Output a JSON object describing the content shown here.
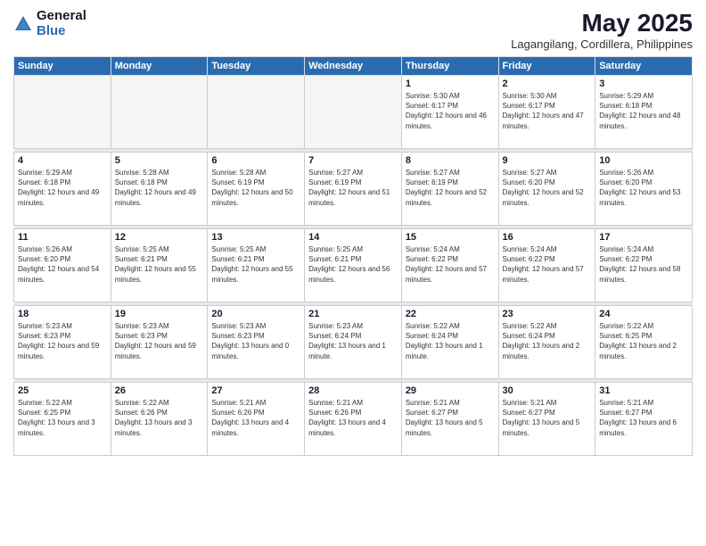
{
  "header": {
    "logo_general": "General",
    "logo_blue": "Blue",
    "month_title": "May 2025",
    "location": "Lagangilang, Cordillera, Philippines"
  },
  "days_of_week": [
    "Sunday",
    "Monday",
    "Tuesday",
    "Wednesday",
    "Thursday",
    "Friday",
    "Saturday"
  ],
  "weeks": [
    {
      "days": [
        {
          "num": "",
          "info": ""
        },
        {
          "num": "",
          "info": ""
        },
        {
          "num": "",
          "info": ""
        },
        {
          "num": "",
          "info": ""
        },
        {
          "num": "1",
          "sunrise": "Sunrise: 5:30 AM",
          "sunset": "Sunset: 6:17 PM",
          "daylight": "Daylight: 12 hours and 46 minutes."
        },
        {
          "num": "2",
          "sunrise": "Sunrise: 5:30 AM",
          "sunset": "Sunset: 6:17 PM",
          "daylight": "Daylight: 12 hours and 47 minutes."
        },
        {
          "num": "3",
          "sunrise": "Sunrise: 5:29 AM",
          "sunset": "Sunset: 6:18 PM",
          "daylight": "Daylight: 12 hours and 48 minutes."
        }
      ]
    },
    {
      "days": [
        {
          "num": "4",
          "sunrise": "Sunrise: 5:29 AM",
          "sunset": "Sunset: 6:18 PM",
          "daylight": "Daylight: 12 hours and 49 minutes."
        },
        {
          "num": "5",
          "sunrise": "Sunrise: 5:28 AM",
          "sunset": "Sunset: 6:18 PM",
          "daylight": "Daylight: 12 hours and 49 minutes."
        },
        {
          "num": "6",
          "sunrise": "Sunrise: 5:28 AM",
          "sunset": "Sunset: 6:19 PM",
          "daylight": "Daylight: 12 hours and 50 minutes."
        },
        {
          "num": "7",
          "sunrise": "Sunrise: 5:27 AM",
          "sunset": "Sunset: 6:19 PM",
          "daylight": "Daylight: 12 hours and 51 minutes."
        },
        {
          "num": "8",
          "sunrise": "Sunrise: 5:27 AM",
          "sunset": "Sunset: 6:19 PM",
          "daylight": "Daylight: 12 hours and 52 minutes."
        },
        {
          "num": "9",
          "sunrise": "Sunrise: 5:27 AM",
          "sunset": "Sunset: 6:20 PM",
          "daylight": "Daylight: 12 hours and 52 minutes."
        },
        {
          "num": "10",
          "sunrise": "Sunrise: 5:26 AM",
          "sunset": "Sunset: 6:20 PM",
          "daylight": "Daylight: 12 hours and 53 minutes."
        }
      ]
    },
    {
      "days": [
        {
          "num": "11",
          "sunrise": "Sunrise: 5:26 AM",
          "sunset": "Sunset: 6:20 PM",
          "daylight": "Daylight: 12 hours and 54 minutes."
        },
        {
          "num": "12",
          "sunrise": "Sunrise: 5:25 AM",
          "sunset": "Sunset: 6:21 PM",
          "daylight": "Daylight: 12 hours and 55 minutes."
        },
        {
          "num": "13",
          "sunrise": "Sunrise: 5:25 AM",
          "sunset": "Sunset: 6:21 PM",
          "daylight": "Daylight: 12 hours and 55 minutes."
        },
        {
          "num": "14",
          "sunrise": "Sunrise: 5:25 AM",
          "sunset": "Sunset: 6:21 PM",
          "daylight": "Daylight: 12 hours and 56 minutes."
        },
        {
          "num": "15",
          "sunrise": "Sunrise: 5:24 AM",
          "sunset": "Sunset: 6:22 PM",
          "daylight": "Daylight: 12 hours and 57 minutes."
        },
        {
          "num": "16",
          "sunrise": "Sunrise: 5:24 AM",
          "sunset": "Sunset: 6:22 PM",
          "daylight": "Daylight: 12 hours and 57 minutes."
        },
        {
          "num": "17",
          "sunrise": "Sunrise: 5:24 AM",
          "sunset": "Sunset: 6:22 PM",
          "daylight": "Daylight: 12 hours and 58 minutes."
        }
      ]
    },
    {
      "days": [
        {
          "num": "18",
          "sunrise": "Sunrise: 5:23 AM",
          "sunset": "Sunset: 6:23 PM",
          "daylight": "Daylight: 12 hours and 59 minutes."
        },
        {
          "num": "19",
          "sunrise": "Sunrise: 5:23 AM",
          "sunset": "Sunset: 6:23 PM",
          "daylight": "Daylight: 12 hours and 59 minutes."
        },
        {
          "num": "20",
          "sunrise": "Sunrise: 5:23 AM",
          "sunset": "Sunset: 6:23 PM",
          "daylight": "Daylight: 13 hours and 0 minutes."
        },
        {
          "num": "21",
          "sunrise": "Sunrise: 5:23 AM",
          "sunset": "Sunset: 6:24 PM",
          "daylight": "Daylight: 13 hours and 1 minute."
        },
        {
          "num": "22",
          "sunrise": "Sunrise: 5:22 AM",
          "sunset": "Sunset: 6:24 PM",
          "daylight": "Daylight: 13 hours and 1 minute."
        },
        {
          "num": "23",
          "sunrise": "Sunrise: 5:22 AM",
          "sunset": "Sunset: 6:24 PM",
          "daylight": "Daylight: 13 hours and 2 minutes."
        },
        {
          "num": "24",
          "sunrise": "Sunrise: 5:22 AM",
          "sunset": "Sunset: 6:25 PM",
          "daylight": "Daylight: 13 hours and 2 minutes."
        }
      ]
    },
    {
      "days": [
        {
          "num": "25",
          "sunrise": "Sunrise: 5:22 AM",
          "sunset": "Sunset: 6:25 PM",
          "daylight": "Daylight: 13 hours and 3 minutes."
        },
        {
          "num": "26",
          "sunrise": "Sunrise: 5:22 AM",
          "sunset": "Sunset: 6:26 PM",
          "daylight": "Daylight: 13 hours and 3 minutes."
        },
        {
          "num": "27",
          "sunrise": "Sunrise: 5:21 AM",
          "sunset": "Sunset: 6:26 PM",
          "daylight": "Daylight: 13 hours and 4 minutes."
        },
        {
          "num": "28",
          "sunrise": "Sunrise: 5:21 AM",
          "sunset": "Sunset: 6:26 PM",
          "daylight": "Daylight: 13 hours and 4 minutes."
        },
        {
          "num": "29",
          "sunrise": "Sunrise: 5:21 AM",
          "sunset": "Sunset: 6:27 PM",
          "daylight": "Daylight: 13 hours and 5 minutes."
        },
        {
          "num": "30",
          "sunrise": "Sunrise: 5:21 AM",
          "sunset": "Sunset: 6:27 PM",
          "daylight": "Daylight: 13 hours and 5 minutes."
        },
        {
          "num": "31",
          "sunrise": "Sunrise: 5:21 AM",
          "sunset": "Sunset: 6:27 PM",
          "daylight": "Daylight: 13 hours and 6 minutes."
        }
      ]
    }
  ]
}
